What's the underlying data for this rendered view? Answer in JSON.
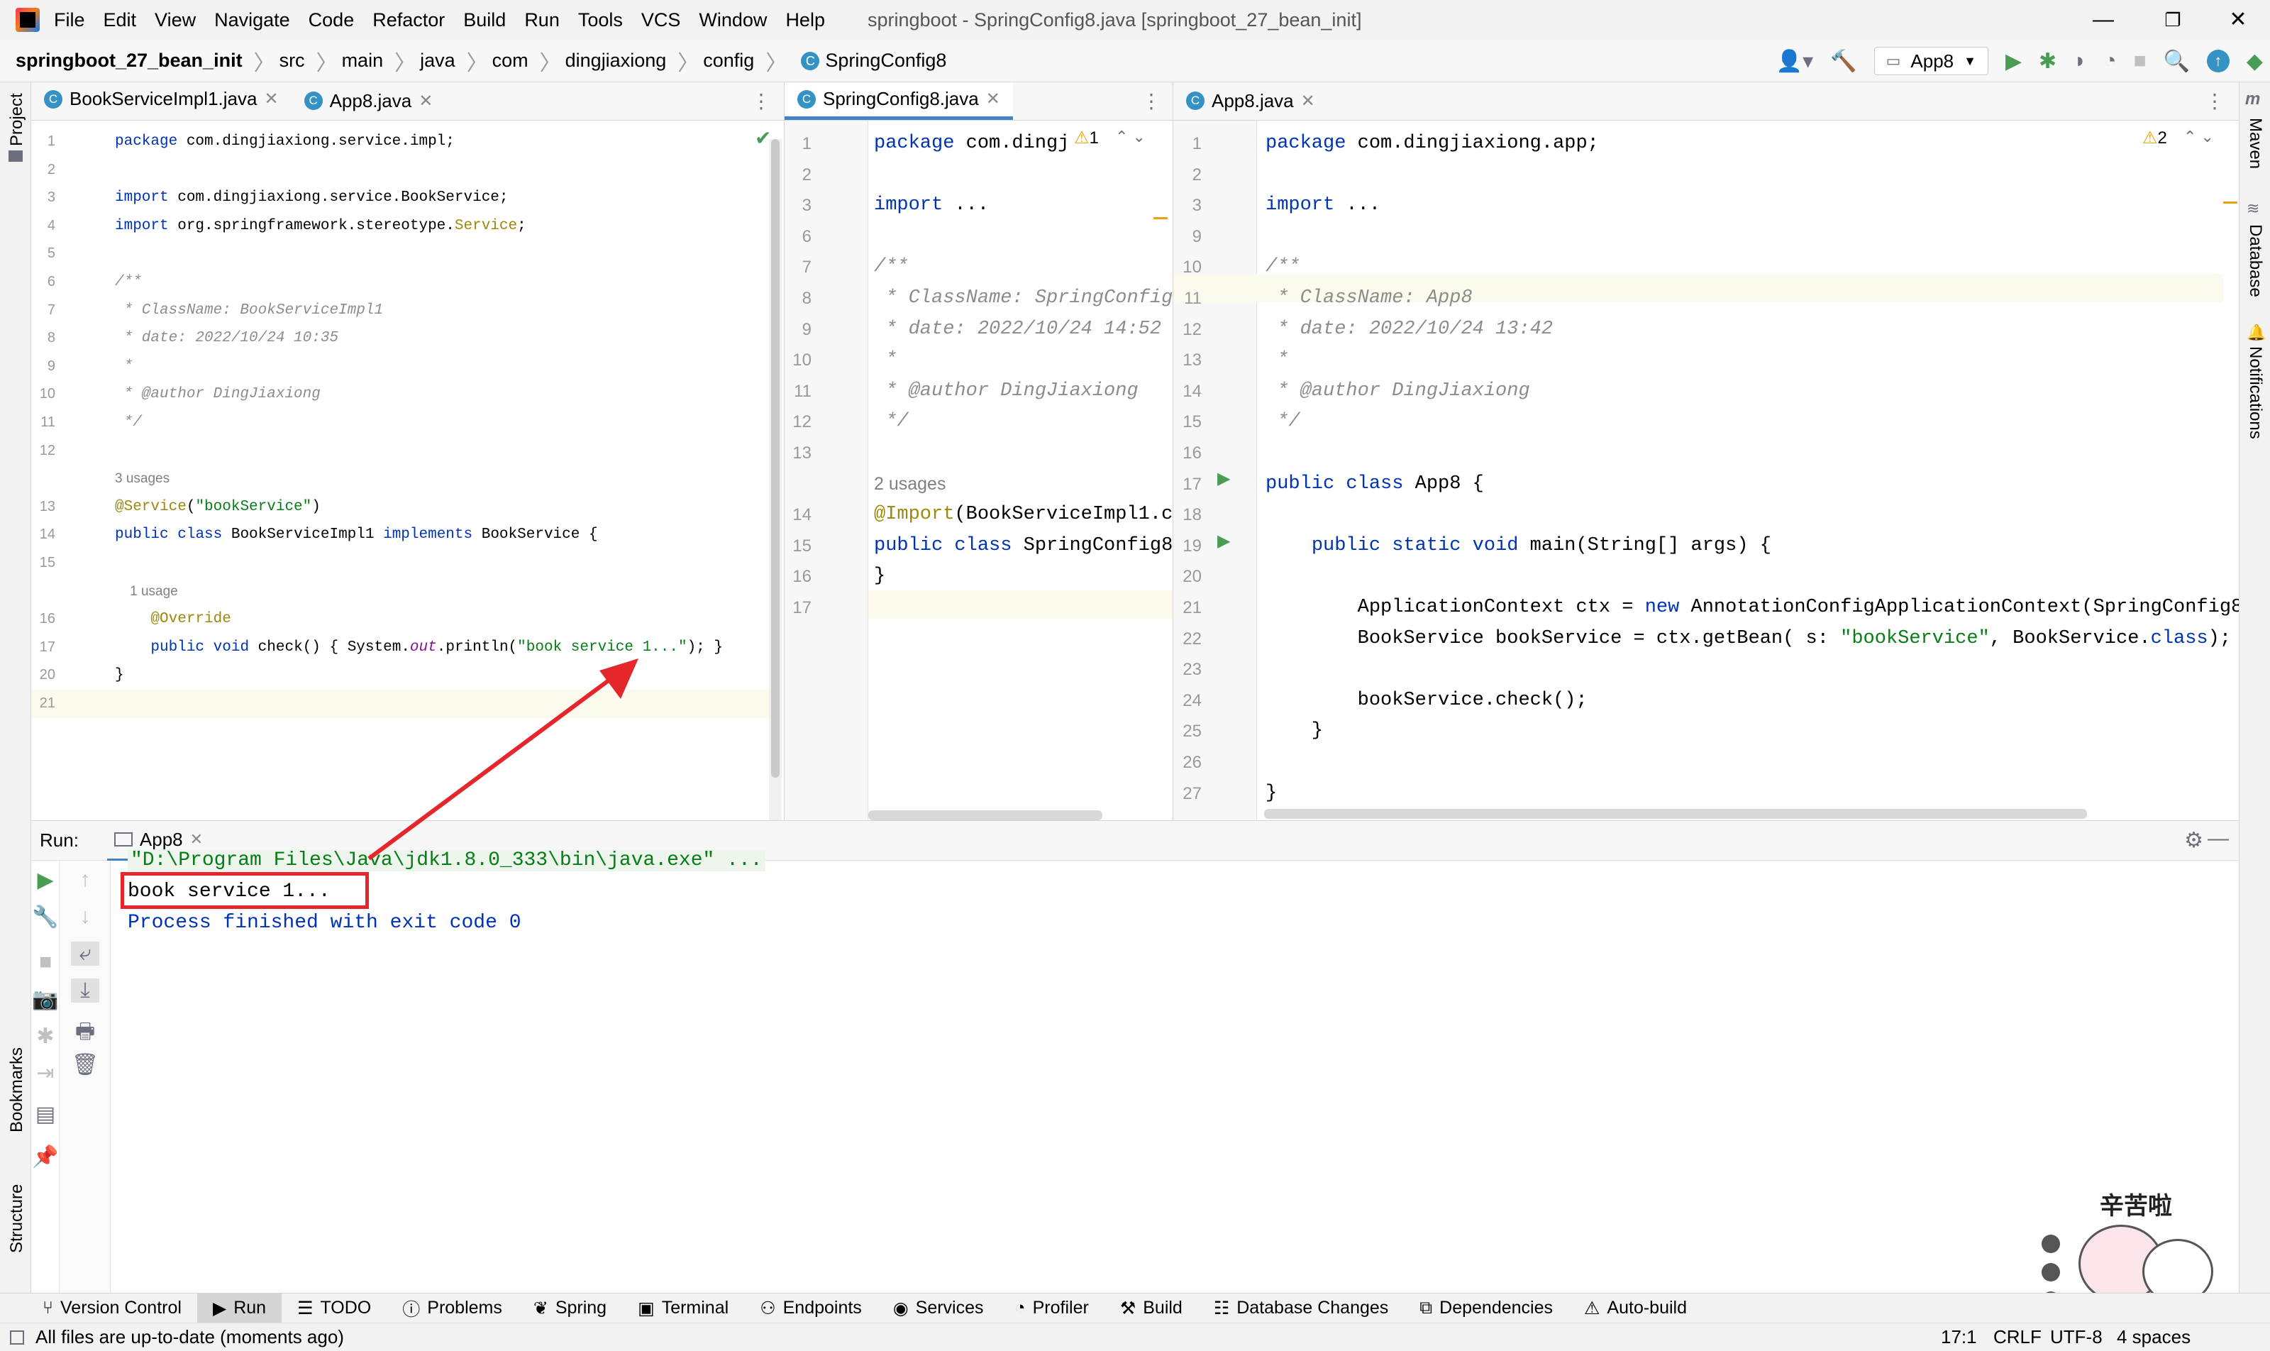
{
  "menubar": {
    "items": [
      "File",
      "Edit",
      "View",
      "Navigate",
      "Code",
      "Refactor",
      "Build",
      "Run",
      "Tools",
      "VCS",
      "Window",
      "Help"
    ],
    "title": "springboot - SpringConfig8.java [springboot_27_bean_init]"
  },
  "navbar": {
    "crumbs": [
      "springboot_27_bean_init",
      "src",
      "main",
      "java",
      "com",
      "dingjiaxiong",
      "config",
      "SpringConfig8"
    ],
    "run_config": "App8"
  },
  "left_strip": {
    "project": "Project",
    "bookmarks": "Bookmarks",
    "structure": "Structure"
  },
  "right_strip": {
    "maven": "Maven",
    "database": "Database",
    "notifications": "Notifications"
  },
  "pane1": {
    "tabs": [
      "BookServiceImpl1.java",
      "App8.java"
    ],
    "lines": [
      {
        "n": "1",
        "t": "package com.dingjiaxiong.service.impl;"
      },
      {
        "n": "2",
        "t": ""
      },
      {
        "n": "3",
        "t": "import com.dingjiaxiong.service.BookService;"
      },
      {
        "n": "4",
        "t": "import org.springframework.stereotype.Service;"
      },
      {
        "n": "5",
        "t": ""
      },
      {
        "n": "6",
        "t": "/**"
      },
      {
        "n": "7",
        "t": " * ClassName: BookServiceImpl1"
      },
      {
        "n": "8",
        "t": " * date: 2022/10/24 10:35"
      },
      {
        "n": "9",
        "t": " *"
      },
      {
        "n": "10",
        "t": " * @author DingJiaxiong"
      },
      {
        "n": "11",
        "t": " */"
      },
      {
        "n": "12",
        "t": ""
      },
      {
        "n": "",
        "t": "3 usages"
      },
      {
        "n": "13",
        "t": "@Service(\"bookService\")"
      },
      {
        "n": "14",
        "t": "public class BookServiceImpl1 implements BookService {"
      },
      {
        "n": "15",
        "t": ""
      },
      {
        "n": "",
        "t": "    1 usage"
      },
      {
        "n": "16",
        "t": "    @Override"
      },
      {
        "n": "17",
        "t": "    public void check() { System.out.println(\"book service 1...\"); }"
      },
      {
        "n": "20",
        "t": "}"
      },
      {
        "n": "21",
        "t": ""
      }
    ]
  },
  "pane2": {
    "tabs": [
      "SpringConfig8.java"
    ],
    "warning_count": "1",
    "lines": [
      {
        "n": "1",
        "t": "package com.dingj"
      },
      {
        "n": "2",
        "t": ""
      },
      {
        "n": "3",
        "t": "import ..."
      },
      {
        "n": "6",
        "t": ""
      },
      {
        "n": "7",
        "t": "/**"
      },
      {
        "n": "8",
        "t": " * ClassName: SpringConfig"
      },
      {
        "n": "9",
        "t": " * date: 2022/10/24 14:52"
      },
      {
        "n": "10",
        "t": " *"
      },
      {
        "n": "11",
        "t": " * @author DingJiaxiong"
      },
      {
        "n": "12",
        "t": " */"
      },
      {
        "n": "13",
        "t": ""
      },
      {
        "n": "",
        "t": "2 usages"
      },
      {
        "n": "14",
        "t": "@Import(BookServiceImpl1.cl"
      },
      {
        "n": "15",
        "t": "public class SpringConfig8"
      },
      {
        "n": "16",
        "t": "}"
      },
      {
        "n": "17",
        "t": ""
      }
    ]
  },
  "pane3": {
    "tabs": [
      "App8.java"
    ],
    "warning_count": "2",
    "lines": [
      {
        "n": "1",
        "t": "package com.dingjiaxiong.app;"
      },
      {
        "n": "2",
        "t": ""
      },
      {
        "n": "3",
        "t": "import ..."
      },
      {
        "n": "9",
        "t": ""
      },
      {
        "n": "10",
        "t": "/**"
      },
      {
        "n": "11",
        "t": " * ClassName: App8"
      },
      {
        "n": "12",
        "t": " * date: 2022/10/24 13:42"
      },
      {
        "n": "13",
        "t": " *"
      },
      {
        "n": "14",
        "t": " * @author DingJiaxiong"
      },
      {
        "n": "15",
        "t": " */"
      },
      {
        "n": "16",
        "t": ""
      },
      {
        "n": "17",
        "t": "public class App8 {"
      },
      {
        "n": "18",
        "t": ""
      },
      {
        "n": "19",
        "t": "    public static void main(String[] args) {"
      },
      {
        "n": "20",
        "t": ""
      },
      {
        "n": "21",
        "t": "        ApplicationContext ctx = new AnnotationConfigApplicationContext(SpringConfig8."
      },
      {
        "n": "22",
        "t": "        BookService bookService = ctx.getBean( s: \"bookService\", BookService.class);"
      },
      {
        "n": "23",
        "t": ""
      },
      {
        "n": "24",
        "t": "        bookService.check();"
      },
      {
        "n": "25",
        "t": "    }"
      },
      {
        "n": "26",
        "t": ""
      },
      {
        "n": "27",
        "t": "}"
      }
    ]
  },
  "run": {
    "label": "Run:",
    "tab": "App8",
    "cmd": "\"D:\\Program Files\\Java\\jdk1.8.0_333\\bin\\java.exe\" ...",
    "output": "book service 1...",
    "exit": "Process finished with exit code 0"
  },
  "bottom_tools": [
    "Version Control",
    "Run",
    "TODO",
    "Problems",
    "Spring",
    "Terminal",
    "Endpoints",
    "Services",
    "Profiler",
    "Build",
    "Database Changes",
    "Dependencies",
    "Auto-build"
  ],
  "status": {
    "message": "All files are up-to-date (moments ago)",
    "position": "17:1",
    "line_sep": "CRLF",
    "encoding": "UTF-8",
    "indent": "4 spaces"
  },
  "sticker": {
    "text": "辛苦啦"
  },
  "colors": {
    "accent": "#4083c9",
    "highlight_box": "#e5262b",
    "keyword": "#0033b3",
    "string": "#067d17",
    "annotation": "#9e880d",
    "comment": "#8c8c8c"
  }
}
